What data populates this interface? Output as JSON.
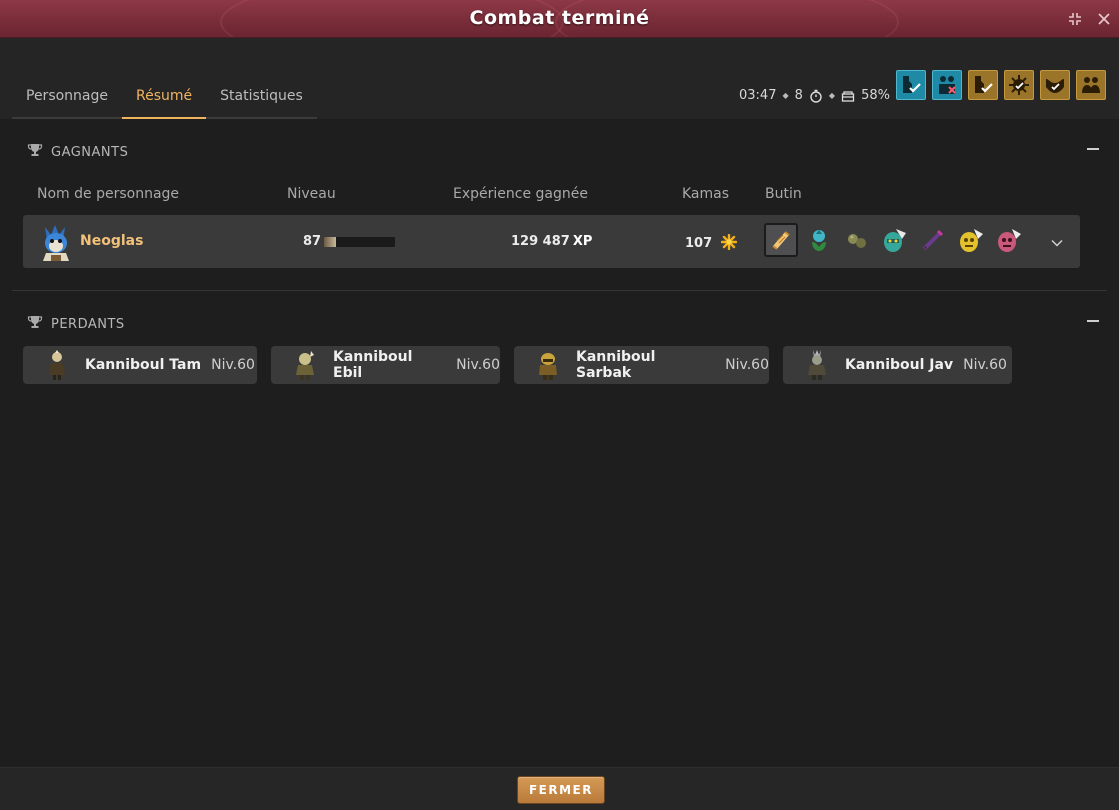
{
  "window": {
    "title": "Combat terminé"
  },
  "tabs": [
    {
      "label": "Personnage",
      "active": false
    },
    {
      "label": "Résumé",
      "active": true
    },
    {
      "label": "Statistiques",
      "active": false
    }
  ],
  "fight_info": {
    "duration": "03:47",
    "turns": "8",
    "percentage": "58%"
  },
  "challenges": [
    {
      "icon": "challenge-icon-1",
      "color": "blue"
    },
    {
      "icon": "challenge-icon-2",
      "color": "blue"
    },
    {
      "icon": "challenge-icon-3",
      "color": "gold"
    },
    {
      "icon": "challenge-icon-4",
      "color": "gold"
    },
    {
      "icon": "challenge-icon-5",
      "color": "gold"
    },
    {
      "icon": "challenge-icon-6",
      "color": "gold"
    }
  ],
  "winners": {
    "title": "GAGNANTS",
    "columns": {
      "name": "Nom de personnage",
      "level": "Niveau",
      "xp": "Expérience gagnée",
      "kamas": "Kamas",
      "loot": "Butin"
    },
    "rows": [
      {
        "name": "Neoglas",
        "level": "87",
        "level_progress": 0.17,
        "xp": "129 487",
        "xp_unit": "XP",
        "kamas": "107",
        "loot_count": 7
      }
    ]
  },
  "losers": {
    "title": "PERDANTS",
    "items": [
      {
        "name": "Kanniboul Tam",
        "level": "Niv.60"
      },
      {
        "name": "Kanniboul Ebil",
        "level": "Niv.60"
      },
      {
        "name": "Kanniboul Sarbak",
        "level": "Niv.60"
      },
      {
        "name": "Kanniboul Jav",
        "level": "Niv.60"
      }
    ]
  },
  "footer": {
    "close_label": "FERMER"
  },
  "colors": {
    "accent": "#f0b35e",
    "titlebar": "#7a2d3a",
    "button": "#c48743"
  }
}
